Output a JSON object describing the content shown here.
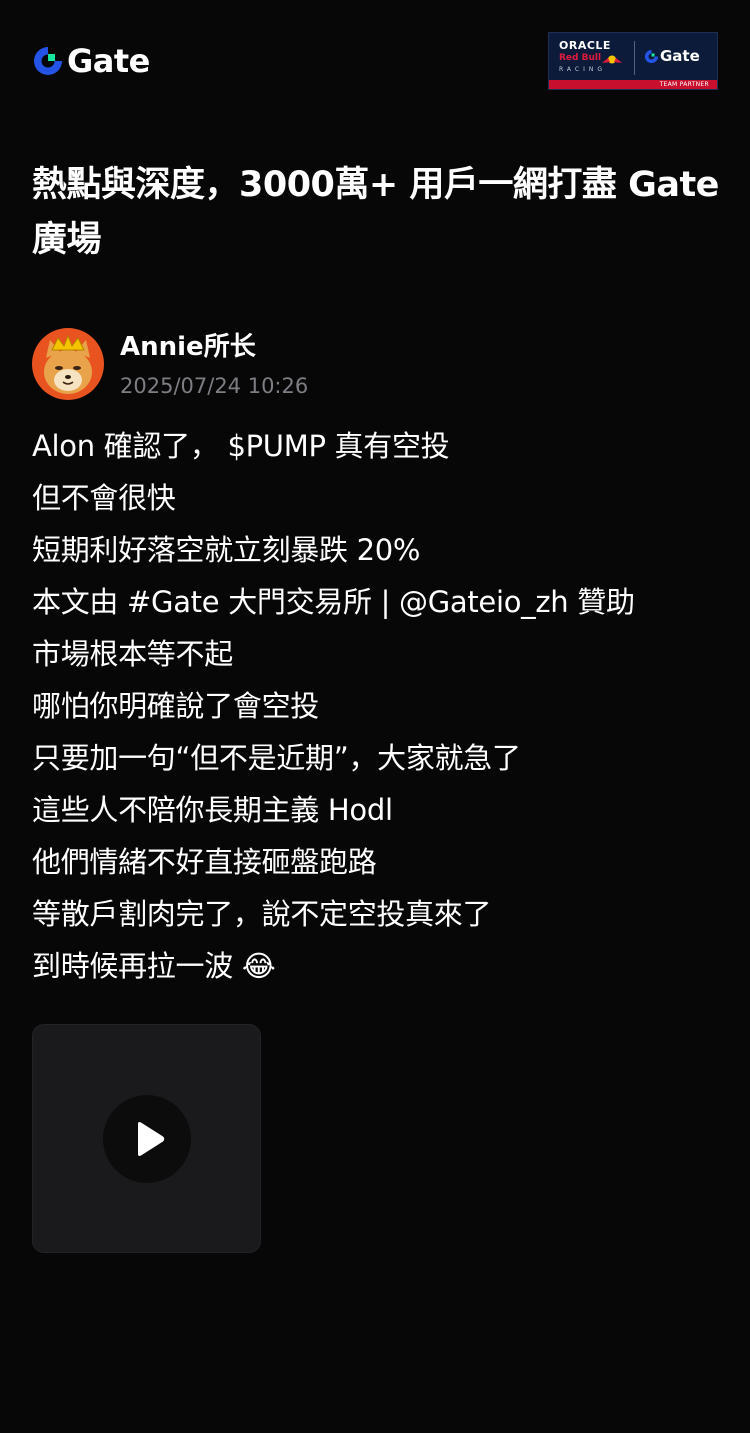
{
  "header": {
    "brand_name": "Gate",
    "partner_badge": {
      "oracle": "ORACLE",
      "red_bull": "Red Bull",
      "racing": "RACING",
      "gate": "Gate",
      "footer": "TEAM PARTNER"
    }
  },
  "article": {
    "title": "熱點與深度，3000萬+ 用戶一網打盡 Gate 廣場"
  },
  "author": {
    "name": "Annie所长",
    "timestamp": "2025/07/24 10:26"
  },
  "post": {
    "lines": [
      "Alon 確認了， $PUMP 真有空投",
      "但不會很快",
      "短期利好落空就立刻暴跌 20%",
      "本文由 #Gate 大門交易所 | @Gateio_zh 贊助",
      "市場根本等不起",
      "哪怕你明確說了會空投",
      "只要加一句“但不是近期”，大家就急了",
      "這些人不陪你長期主義 Hodl",
      "他們情緒不好直接砸盤跑路",
      "等散戶割肉完了，說不定空投真來了",
      "到時候再拉一波 😂"
    ]
  },
  "icons": {
    "brand": "gate-logo-icon",
    "avatar": "shiba-dog-avatar",
    "play": "play-icon"
  },
  "colors": {
    "background": "#070708",
    "brand_blue": "#2354e6",
    "brand_green": "#17e6a1",
    "muted_text": "#7d7d84",
    "badge_navy": "#0c1b3a",
    "badge_red": "#c8102e"
  }
}
